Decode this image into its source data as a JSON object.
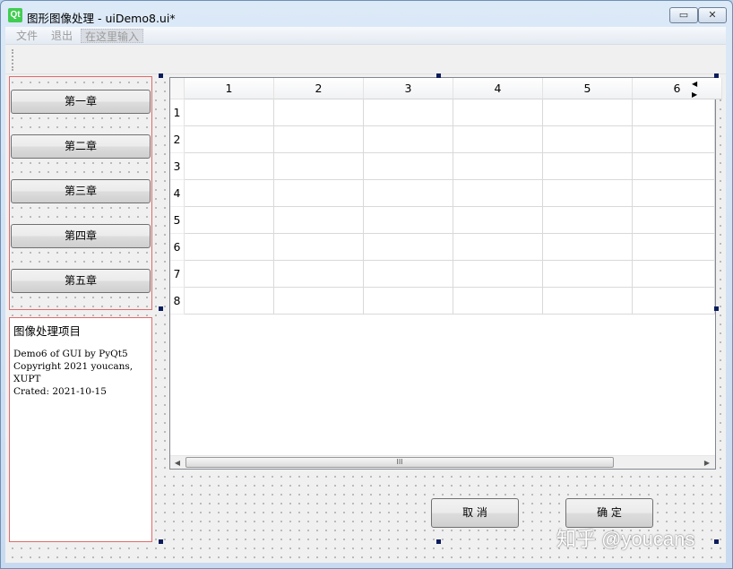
{
  "window": {
    "title": "图形图像处理 - uiDemo8.ui*",
    "logo": "Qt",
    "minimize_glyph": "▭",
    "close_glyph": "✕"
  },
  "menu": {
    "items": [
      "文件",
      "退出"
    ],
    "input_placeholder": "在这里输入"
  },
  "chapters": [
    "第一章",
    "第二章",
    "第三章",
    "第四章",
    "第五章"
  ],
  "textbox": {
    "title": "图像处理项目",
    "lines": [
      "Demo6 of GUI by PyQt5",
      "Copyright 2021 youcans,",
      "XUPT",
      "Crated: 2021-10-15"
    ]
  },
  "table": {
    "columns": [
      "1",
      "2",
      "3",
      "4",
      "5",
      "6"
    ],
    "rows": [
      "1",
      "2",
      "3",
      "4",
      "5",
      "6",
      "7",
      "8"
    ],
    "tab_arrows": "◀ ▶",
    "scroll_left": "◀",
    "scroll_right": "▶",
    "scroll_grip": "III"
  },
  "actions": {
    "cancel": "取 消",
    "ok": "确 定"
  },
  "watermark": "知乎 @youcans"
}
